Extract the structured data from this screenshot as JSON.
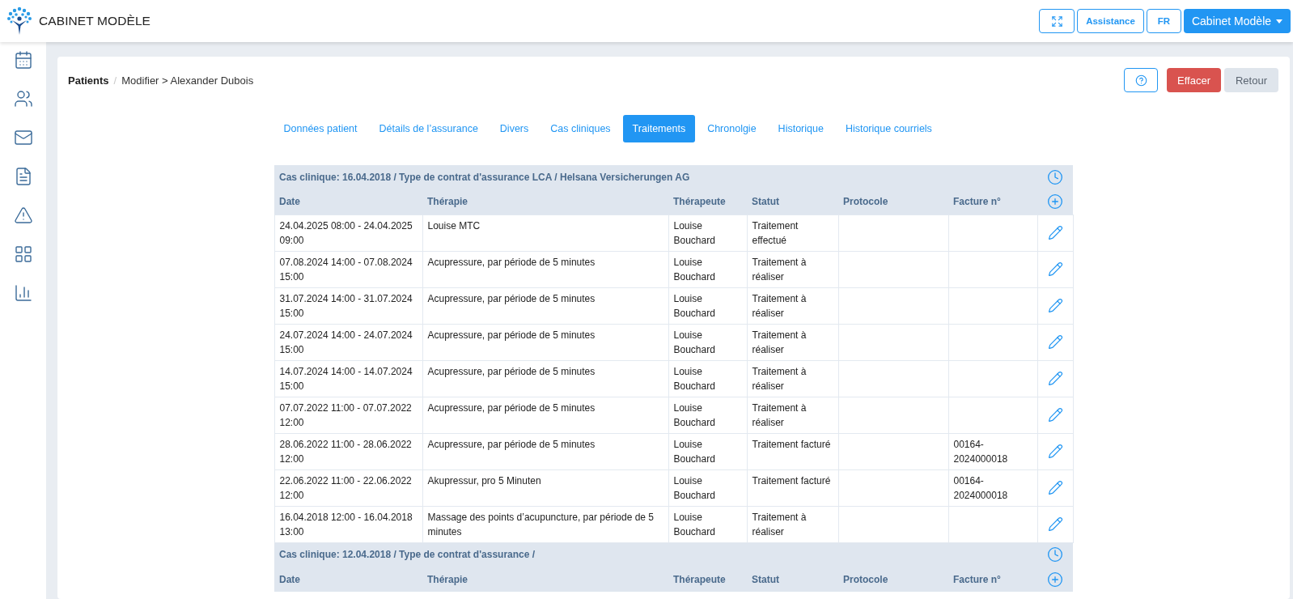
{
  "header": {
    "title": "CABINET MODÈLE",
    "buttons": [
      {
        "kind": "icon"
      },
      {
        "kind": "outline",
        "label": "Assistance"
      },
      {
        "kind": "outline",
        "label": "FR"
      },
      {
        "kind": "menu",
        "label": "Cabinet Modèle"
      }
    ]
  },
  "breadcrumb": {
    "root": "Patients",
    "separator": "/",
    "current": "Modifier > Alexander Dubois"
  },
  "actions": [
    {
      "kind": "help"
    },
    {
      "kind": "danger",
      "label": "Effacer"
    },
    {
      "kind": "secondary",
      "label": "Retour"
    }
  ],
  "tabs": [
    {
      "label": "Données patient",
      "selected": false
    },
    {
      "label": "Détails de l’assurance",
      "selected": false
    },
    {
      "label": "Divers",
      "selected": false
    },
    {
      "label": "Cas cliniques",
      "selected": false
    },
    {
      "label": "Traitements",
      "selected": true
    },
    {
      "label": "Chronolgie",
      "selected": false
    },
    {
      "label": "Historique",
      "selected": false
    },
    {
      "label": "Historique courriels",
      "selected": false
    }
  ],
  "case_groups": [
    {
      "title": "Cas clinique: 16.04.2018 / Type de contrat d'assurance LCA / Helsana Versicherungen AG",
      "columns": [
        "Date",
        "Thérapie",
        "Thérapeute",
        "Statut",
        "Protocole",
        "Facture n°"
      ],
      "rows": [
        {
          "date": "24.04.2025 08:00 - 24.04.2025 09:00",
          "therapy": "Louise MTC",
          "therapist": "Louise Bouchard",
          "status": "Traitement effectué"
        },
        {
          "date": "07.08.2024 14:00 - 07.08.2024 15:00",
          "therapy": "Acupressure, par période de 5 minutes",
          "therapist": "Louise Bouchard",
          "status": "Traitement à réaliser"
        },
        {
          "date": "31.07.2024 14:00 - 31.07.2024 15:00",
          "therapy": "Acupressure, par période de 5 minutes",
          "therapist": "Louise Bouchard",
          "status": "Traitement à réaliser"
        },
        {
          "date": "24.07.2024 14:00 - 24.07.2024 15:00",
          "therapy": "Acupressure, par période de 5 minutes",
          "therapist": "Louise Bouchard",
          "status": "Traitement à réaliser"
        },
        {
          "date": "14.07.2024 14:00 - 14.07.2024 15:00",
          "therapy": "Acupressure, par période de 5 minutes",
          "therapist": "Louise Bouchard",
          "status": "Traitement à réaliser"
        },
        {
          "date": "07.07.2022 11:00 - 07.07.2022 12:00",
          "therapy": "Acupressure, par période de 5 minutes",
          "therapist": "Louise Bouchard",
          "status": "Traitement à réaliser"
        },
        {
          "date": "28.06.2022 11:00 - 28.06.2022 12:00",
          "therapy": "Acupressure, par période de 5 minutes",
          "therapist": "Louise Bouchard",
          "status": "Traitement facturé",
          "invoice": "00164-2024000018"
        },
        {
          "date": "22.06.2022 11:00 - 22.06.2022 12:00",
          "therapy": "Akupressur, pro 5 Minuten",
          "therapist": "Louise Bouchard",
          "status": "Traitement facturé",
          "invoice": "00164-2024000018"
        },
        {
          "date": "16.04.2018 12:00 - 16.04.2018 13:00",
          "therapy": "Massage des points d’acupuncture, par période de 5 minutes",
          "therapist": "Louise Bouchard",
          "status": "Traitement à réaliser"
        }
      ]
    },
    {
      "title": "Cas clinique: 12.04.2018 / Type de contrat d'assurance /",
      "columns": [
        "Date",
        "Thérapie",
        "Thérapeute",
        "Statut",
        "Protocole",
        "Facture n°"
      ]
    }
  ]
}
